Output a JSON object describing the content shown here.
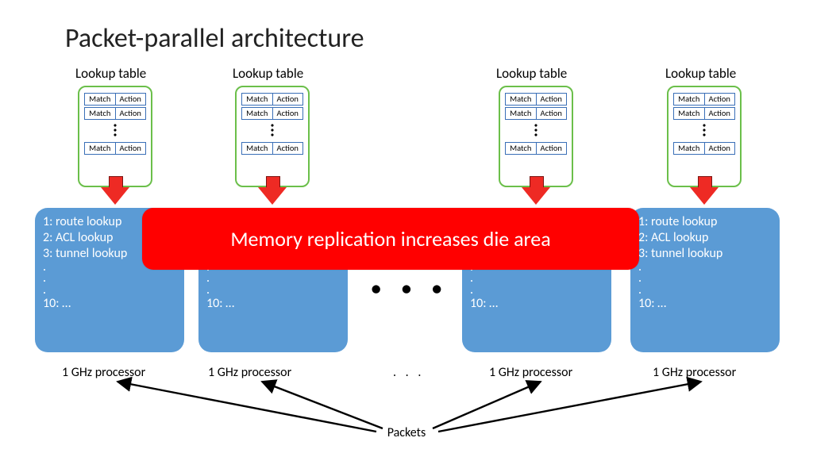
{
  "title": "Packet-parallel architecture",
  "lookup_table_label": "Lookup table",
  "match_label": "Match",
  "action_label": "Action",
  "callout_text": "Memory replication increases die area",
  "proc_lines": {
    "l1": "1: route lookup",
    "l2": "2: ACL lookup",
    "l3": "3: tunnel lookup",
    "d": ".",
    "l10": "10: …"
  },
  "processor_label": "1 GHz processor",
  "packets_label": "Packets",
  "ellipsis": "● ● ●",
  "proc_dots": ". . ."
}
